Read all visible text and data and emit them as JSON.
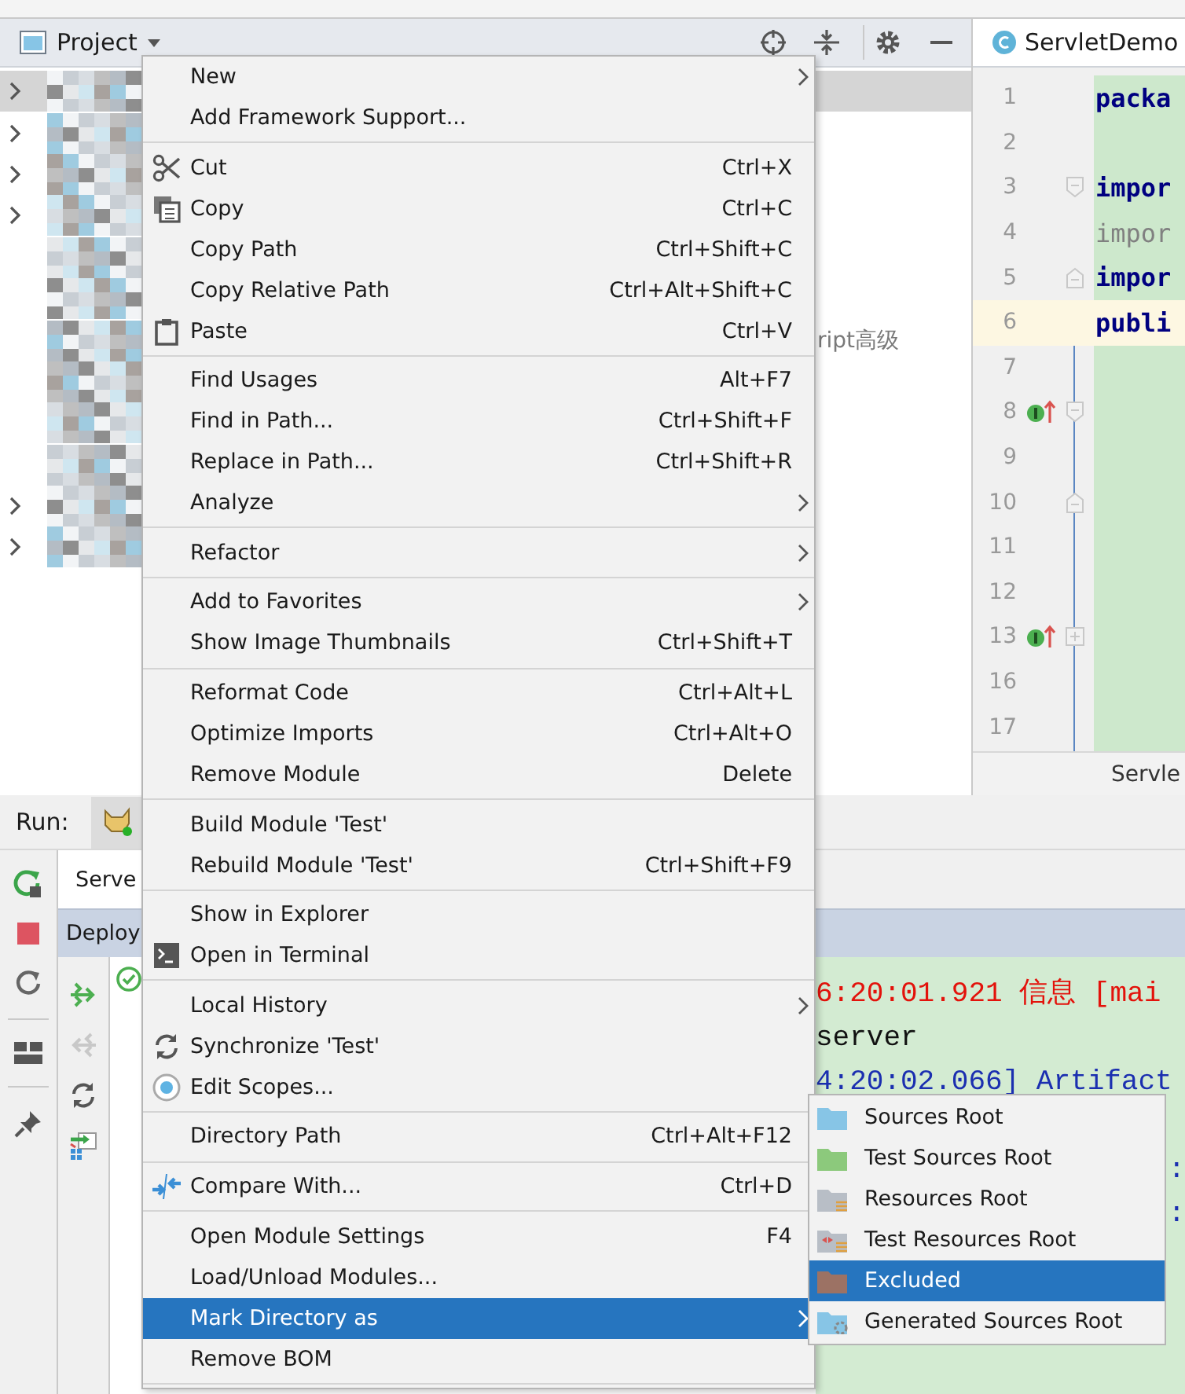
{
  "project": {
    "title": "Project",
    "tree": [
      {
        "selected": true,
        "expandable": true
      },
      {
        "selected": false,
        "expandable": true
      },
      {
        "selected": false,
        "expandable": true
      },
      {
        "selected": false,
        "expandable": true
      },
      {
        "selected": false,
        "expandable": false
      },
      {
        "selected": false,
        "expandable": false
      },
      {
        "selected": false,
        "expandable": false,
        "text": "ript高级"
      },
      {
        "selected": false,
        "expandable": false
      },
      {
        "selected": false,
        "expandable": false
      },
      {
        "selected": false,
        "expandable": false
      },
      {
        "selected": false,
        "expandable": true
      },
      {
        "selected": false,
        "expandable": true
      }
    ]
  },
  "editor": {
    "tab": "ServletDemo",
    "bottom_tab": "Servle",
    "lines": [
      {
        "number": "1",
        "code": "packa",
        "unused": false,
        "kind": "plain",
        "override": false,
        "current": false
      },
      {
        "number": "2",
        "kind": "plain",
        "override": false,
        "current": false
      },
      {
        "number": "3",
        "code": "impor",
        "unused": false,
        "kind": "fold_start",
        "override": false,
        "current": false
      },
      {
        "number": "4",
        "code": "impor",
        "unused": true,
        "kind": "plain",
        "override": false,
        "current": false
      },
      {
        "number": "5",
        "code": "impor",
        "unused": false,
        "kind": "fold_end",
        "override": false,
        "current": false
      },
      {
        "number": "6",
        "code": "publi",
        "unused": false,
        "kind": "plain",
        "override": false,
        "current": true
      },
      {
        "number": "7",
        "kind": "plain",
        "override": false,
        "current": false
      },
      {
        "number": "8",
        "kind": "fold_start",
        "override": true,
        "current": false
      },
      {
        "number": "9",
        "kind": "plain",
        "override": false,
        "current": false
      },
      {
        "number": "10",
        "kind": "fold_end",
        "override": false,
        "current": false
      },
      {
        "number": "11",
        "kind": "plain",
        "override": false,
        "current": false
      },
      {
        "number": "12",
        "kind": "plain",
        "override": false,
        "current": false
      },
      {
        "number": "13",
        "kind": "fold_collapsed",
        "override": true,
        "current": false
      },
      {
        "number": "16",
        "kind": "plain",
        "override": false,
        "current": false
      },
      {
        "number": "17",
        "kind": "plain",
        "override": false,
        "current": false
      }
    ]
  },
  "run": {
    "label": "Run:",
    "server_tab": "Serve",
    "deploy_header": "Deploy",
    "console": [
      {
        "text": "6:20:01.921 信息 [mai",
        "kind": "error"
      },
      {
        "text": "server",
        "kind": "plain"
      },
      {
        "text": "4:20:02.066] Artifact",
        "kind": "info"
      }
    ],
    "console_tail": [
      {
        "text": ":",
        "kind": "info"
      },
      {
        "text": ":",
        "kind": "info"
      }
    ]
  },
  "context_menu": {
    "groups": [
      [
        {
          "label": "New",
          "submenu": true,
          "selected": false
        },
        {
          "label": "Add Framework Support...",
          "submenu": false,
          "selected": false
        }
      ],
      [
        {
          "label": "Cut",
          "shortcut": "Ctrl+X",
          "submenu": false,
          "selected": false
        },
        {
          "label": "Copy",
          "shortcut": "Ctrl+C",
          "submenu": false,
          "selected": false
        },
        {
          "label": "Copy Path",
          "shortcut": "Ctrl+Shift+C",
          "submenu": false,
          "selected": false
        },
        {
          "label": "Copy Relative Path",
          "shortcut": "Ctrl+Alt+Shift+C",
          "submenu": false,
          "selected": false
        },
        {
          "label": "Paste",
          "shortcut": "Ctrl+V",
          "submenu": false,
          "selected": false
        }
      ],
      [
        {
          "label": "Find Usages",
          "shortcut": "Alt+F7",
          "submenu": false,
          "selected": false
        },
        {
          "label": "Find in Path...",
          "shortcut": "Ctrl+Shift+F",
          "submenu": false,
          "selected": false
        },
        {
          "label": "Replace in Path...",
          "shortcut": "Ctrl+Shift+R",
          "submenu": false,
          "selected": false
        },
        {
          "label": "Analyze",
          "submenu": true,
          "selected": false
        }
      ],
      [
        {
          "label": "Refactor",
          "submenu": true,
          "selected": false
        }
      ],
      [
        {
          "label": "Add to Favorites",
          "submenu": true,
          "selected": false
        },
        {
          "label": "Show Image Thumbnails",
          "shortcut": "Ctrl+Shift+T",
          "submenu": false,
          "selected": false
        }
      ],
      [
        {
          "label": "Reformat Code",
          "shortcut": "Ctrl+Alt+L",
          "submenu": false,
          "selected": false
        },
        {
          "label": "Optimize Imports",
          "shortcut": "Ctrl+Alt+O",
          "submenu": false,
          "selected": false
        },
        {
          "label": "Remove Module",
          "shortcut": "Delete",
          "submenu": false,
          "selected": false
        }
      ],
      [
        {
          "label": "Build Module 'Test'",
          "submenu": false,
          "selected": false
        },
        {
          "label": "Rebuild Module 'Test'",
          "shortcut": "Ctrl+Shift+F9",
          "submenu": false,
          "selected": false
        }
      ],
      [
        {
          "label": "Show in Explorer",
          "submenu": false,
          "selected": false
        },
        {
          "label": "Open in Terminal",
          "submenu": false,
          "selected": false
        }
      ],
      [
        {
          "label": "Local History",
          "submenu": true,
          "selected": false
        },
        {
          "label": "Synchronize 'Test'",
          "submenu": false,
          "selected": false
        },
        {
          "label": "Edit Scopes...",
          "submenu": false,
          "selected": false
        }
      ],
      [
        {
          "label": "Directory Path",
          "shortcut": "Ctrl+Alt+F12",
          "submenu": false,
          "selected": false
        }
      ],
      [
        {
          "label": "Compare With...",
          "shortcut": "Ctrl+D",
          "submenu": false,
          "selected": false
        }
      ],
      [
        {
          "label": "Open Module Settings",
          "shortcut": "F4",
          "submenu": false,
          "selected": false
        },
        {
          "label": "Load/Unload Modules...",
          "submenu": false,
          "selected": false
        },
        {
          "label": "Mark Directory as",
          "submenu": true,
          "selected": true
        },
        {
          "label": "Remove BOM",
          "submenu": false,
          "selected": false
        }
      ]
    ]
  },
  "submenu": [
    {
      "label": "Sources Root",
      "selected": false,
      "color": "#87c5e6"
    },
    {
      "label": "Test Sources Root",
      "selected": false,
      "color": "#8cc97c"
    },
    {
      "label": "Resources Root",
      "selected": false,
      "color": "#b8bec6"
    },
    {
      "label": "Test Resources Root",
      "selected": false,
      "color": "#b8bec6"
    },
    {
      "label": "Excluded",
      "selected": true,
      "color": "#9c7264"
    },
    {
      "label": "Generated Sources Root",
      "selected": false,
      "color": "#87c5e6"
    }
  ]
}
